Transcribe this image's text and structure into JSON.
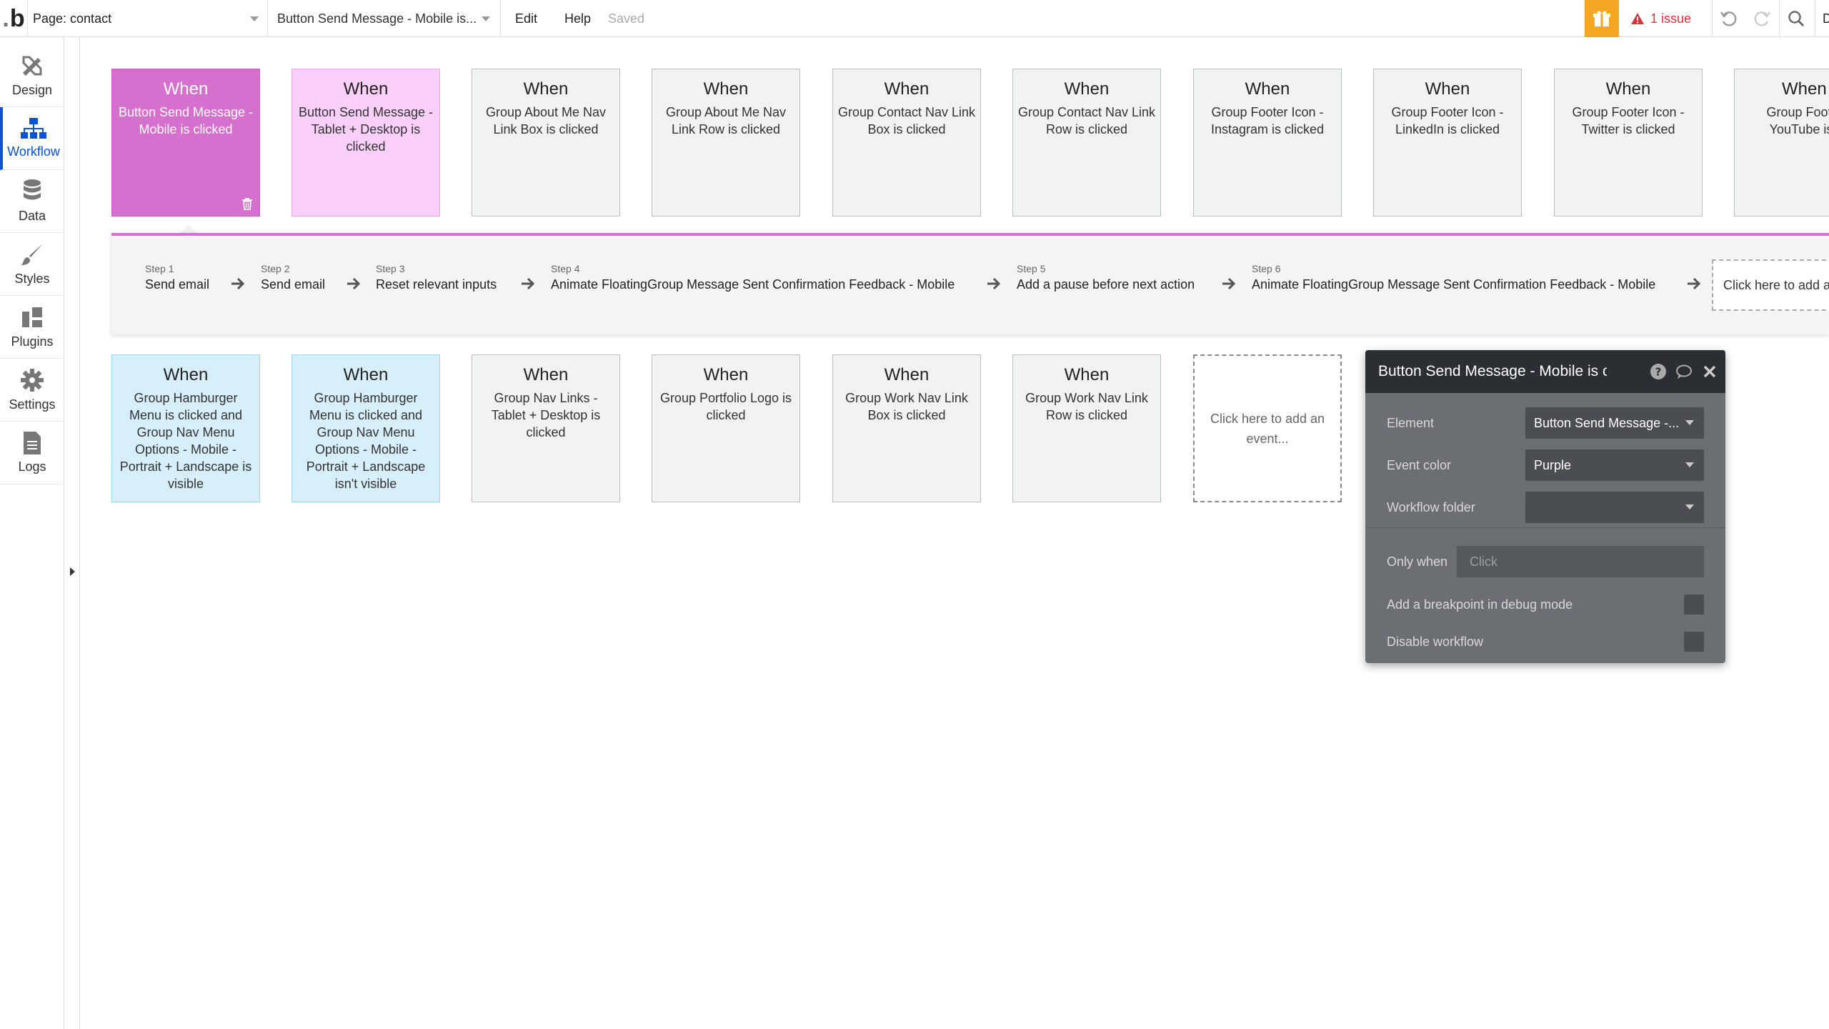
{
  "topbar": {
    "logo_text": "b",
    "page_label": "Page: contact",
    "workflow_label": "Button Send Message - Mobile is...",
    "menu": {
      "edit": "Edit",
      "help": "Help"
    },
    "save_status": "Saved",
    "issues": "1 issue",
    "icons": [
      "gift-icon",
      "warning-icon",
      "undo-icon",
      "redo-icon",
      "search-icon"
    ],
    "colors": {
      "gift": "#f5a623",
      "issue": "#e0303a"
    }
  },
  "sidebar": {
    "items": [
      {
        "label": "Design",
        "icon": "design-icon"
      },
      {
        "label": "Workflow",
        "icon": "workflow-icon",
        "active": true
      },
      {
        "label": "Data",
        "icon": "database-icon"
      },
      {
        "label": "Styles",
        "icon": "brush-icon"
      },
      {
        "label": "Plugins",
        "icon": "plugins-icon"
      },
      {
        "label": "Settings",
        "icon": "gear-icon"
      },
      {
        "label": "Logs",
        "icon": "logs-icon"
      }
    ],
    "active_color": "#0b52d5"
  },
  "events_top": [
    {
      "when": "When",
      "desc": "Button Send Message - Mobile is clicked",
      "color": "purple"
    },
    {
      "when": "When",
      "desc": "Button Send Message - Tablet + Desktop is clicked",
      "color": "pink"
    },
    {
      "when": "When",
      "desc": "Group About Me Nav Link Box is clicked",
      "color": "gray"
    },
    {
      "when": "When",
      "desc": "Group About Me Nav Link Row is clicked",
      "color": "gray"
    },
    {
      "when": "When",
      "desc": "Group Contact Nav Link Box is clicked",
      "color": "gray"
    },
    {
      "when": "When",
      "desc": "Group Contact Nav Link Row is clicked",
      "color": "gray"
    },
    {
      "when": "When",
      "desc": "Group Footer Icon - Instagram is clicked",
      "color": "gray"
    },
    {
      "when": "When",
      "desc": "Group Footer Icon - LinkedIn is clicked",
      "color": "gray"
    },
    {
      "when": "When",
      "desc": "Group Footer Icon - Twitter is clicked",
      "color": "gray"
    },
    {
      "when": "When",
      "desc": "Group Footer Icon - YouTube is clicked",
      "color": "gray"
    }
  ],
  "steps": [
    {
      "num": "Step 1",
      "text": "Send email"
    },
    {
      "num": "Step 2",
      "text": "Send email"
    },
    {
      "num": "Step 3",
      "text": "Reset relevant inputs"
    },
    {
      "num": "Step 4",
      "text": "Animate FloatingGroup Message Sent Confirmation Feedback - Mobile"
    },
    {
      "num": "Step 5",
      "text": "Add a pause before next action"
    },
    {
      "num": "Step 6",
      "text": "Animate FloatingGroup Message Sent Confirmation Feedback - Mobile"
    }
  ],
  "add_action": "Click here to add an action...",
  "events_bottom": [
    {
      "when": "When",
      "desc": "Group Hamburger Menu is clicked and Group Nav Menu Options - Mobile - Portrait + Landscape is visible",
      "color": "blue"
    },
    {
      "when": "When",
      "desc": "Group Hamburger Menu is clicked and Group Nav Menu Options - Mobile - Portrait + Landscape isn't visible",
      "color": "blue"
    },
    {
      "when": "When",
      "desc": "Group Nav Links - Tablet + Desktop is clicked",
      "color": "gray"
    },
    {
      "when": "When",
      "desc": "Group Portfolio Logo is clicked",
      "color": "gray"
    },
    {
      "when": "When",
      "desc": "Group Work Nav Link Box is clicked",
      "color": "gray"
    },
    {
      "when": "When",
      "desc": "Group Work Nav Link Row is clicked",
      "color": "gray"
    }
  ],
  "add_event": "Click here to add an event...",
  "panel": {
    "title": "Button Send Message - Mobile is clicked",
    "element_label": "Element",
    "element_value": "Button Send Message -...",
    "color_label": "Event color",
    "color_value": "Purple",
    "folder_label": "Workflow folder",
    "folder_value": "",
    "only_when_label": "Only when",
    "only_when_placeholder": "Click",
    "breakpoint_label": "Add a breakpoint in debug mode",
    "disable_label": "Disable workflow"
  }
}
